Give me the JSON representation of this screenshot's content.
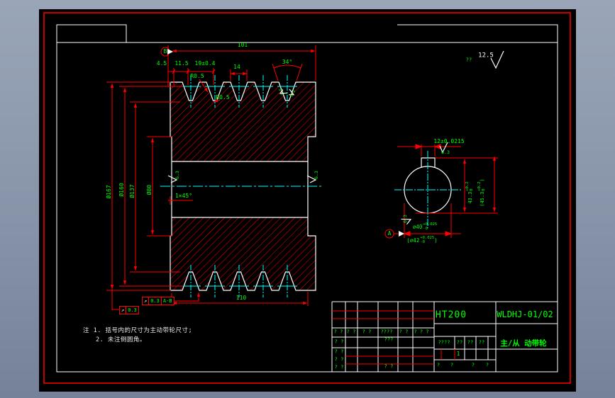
{
  "annotations": {
    "general_roughness_prefix": "??",
    "general_roughness_value": "12.5",
    "datum_top": "B",
    "datum_side": "A",
    "note_line1": "注 1. 括号内的尺寸为主动带轮尺寸;",
    "note_line2": "2. 未注倒圆角。"
  },
  "dims": {
    "total_width": "101",
    "edge_offset": "4.5",
    "groove_offset": "11.5",
    "groove_pitch": "19±0.4",
    "groove_top_width": "14",
    "groove_angle": "34°",
    "groove_radius_top": "R0.5",
    "groove_radius_bottom": "R0.5",
    "flank_rough_left": "3.2",
    "flank_rough_right": "3.2",
    "outer_dia": "Ø167",
    "pitch_dia": "Ø160",
    "root_dia": "Ø137",
    "hub_dia": "Ø80",
    "hub_width": "110",
    "bore_chamfer": "1×45°",
    "bore_rough_left": "6.3",
    "bore_rough_right": "6.3"
  },
  "runout": {
    "f1_symbol": "↗",
    "f1_value": "0.3",
    "f1_datum": "A-B",
    "f2_symbol": "↗",
    "f2_value": "0.3"
  },
  "side_view": {
    "keyway_width": "12±0.0215",
    "keyway_rough": "6.3",
    "bore_rough": "6.3",
    "depth_main": "43.3",
    "depth_tol_up": "+0.2",
    "depth_tol_dn": "0",
    "depth_alt_main": "(45.3",
    "depth_alt_tol_up": "+0.2",
    "depth_alt_tol_dn": "0",
    "depth_alt_close": ")",
    "bore_main": "⌀40",
    "bore_tol_up": "+0.025",
    "bore_tol_dn": "-0",
    "bore_alt_main": "(⌀42",
    "bore_alt_tol_up": "+0.025",
    "bore_alt_tol_dn": "-0",
    "bore_alt_close": ")"
  },
  "title_block": {
    "material": "HT200",
    "drawing_no": "WLDHJ-01/02",
    "part_name": "主/从 动带轮",
    "header_cells": [
      "? ?",
      "? ?",
      "? ?",
      "????",
      "? ?",
      "? ? ?"
    ],
    "left_rows": [
      "? ?",
      "? ?",
      "? ?",
      "? ?"
    ],
    "center_top": "???",
    "center_bottom": "? ?",
    "scale_cells": [
      "????",
      "??",
      "??",
      "??"
    ],
    "qty": "1",
    "bottom_cells": [
      "?",
      "?",
      "?",
      "?"
    ]
  }
}
